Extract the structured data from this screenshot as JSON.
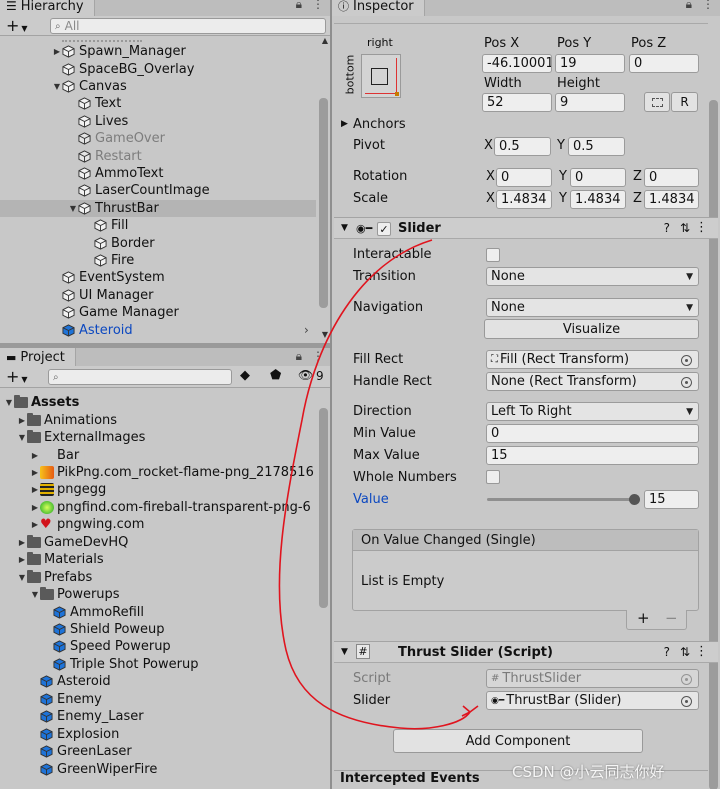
{
  "hierarchy": {
    "tab": "Hierarchy",
    "search_placeholder": "All",
    "items": [
      {
        "label": "Spawn_Manager",
        "depth": 1,
        "arrow": "▶",
        "style": ""
      },
      {
        "label": "SpaceBG_Overlay",
        "depth": 1,
        "arrow": "",
        "style": ""
      },
      {
        "label": "Canvas",
        "depth": 1,
        "arrow": "▼",
        "style": ""
      },
      {
        "label": "Text",
        "depth": 2,
        "arrow": "",
        "style": ""
      },
      {
        "label": "Lives",
        "depth": 2,
        "arrow": "",
        "style": ""
      },
      {
        "label": "GameOver",
        "depth": 2,
        "arrow": "",
        "style": "dim"
      },
      {
        "label": "Restart",
        "depth": 2,
        "arrow": "",
        "style": "dim"
      },
      {
        "label": "AmmoText",
        "depth": 2,
        "arrow": "",
        "style": ""
      },
      {
        "label": "LaserCountImage",
        "depth": 2,
        "arrow": "",
        "style": ""
      },
      {
        "label": "ThrustBar",
        "depth": 2,
        "arrow": "▼",
        "style": "selected"
      },
      {
        "label": "Fill",
        "depth": 3,
        "arrow": "",
        "style": ""
      },
      {
        "label": "Border",
        "depth": 3,
        "arrow": "",
        "style": ""
      },
      {
        "label": "Fire",
        "depth": 3,
        "arrow": "",
        "style": ""
      },
      {
        "label": "EventSystem",
        "depth": 1,
        "arrow": "",
        "style": ""
      },
      {
        "label": "UI Manager",
        "depth": 1,
        "arrow": "",
        "style": ""
      },
      {
        "label": "Game Manager",
        "depth": 1,
        "arrow": "",
        "style": ""
      },
      {
        "label": "Asteroid",
        "depth": 1,
        "arrow": "",
        "style": "blue"
      }
    ]
  },
  "project": {
    "tab": "Project",
    "badge_count": "9",
    "items": [
      {
        "label": "Assets",
        "depth": 0,
        "arrow": "▼",
        "icon": "folder",
        "bold": true
      },
      {
        "label": "Animations",
        "depth": 1,
        "arrow": "▶",
        "icon": "folder"
      },
      {
        "label": "ExternalImages",
        "depth": 1,
        "arrow": "▼",
        "icon": "folder"
      },
      {
        "label": "Bar",
        "depth": 2,
        "arrow": "▶",
        "icon": "none"
      },
      {
        "label": "PikPng.com_rocket-flame-png_2178516",
        "depth": 2,
        "arrow": "▶",
        "icon": "flame"
      },
      {
        "label": "pngegg",
        "depth": 2,
        "arrow": "▶",
        "icon": "pngegg"
      },
      {
        "label": "pngfind.com-fireball-transparent-png-6",
        "depth": 2,
        "arrow": "▶",
        "icon": "fireball"
      },
      {
        "label": "pngwing.com",
        "depth": 2,
        "arrow": "▶",
        "icon": "heart"
      },
      {
        "label": "GameDevHQ",
        "depth": 1,
        "arrow": "▶",
        "icon": "folder"
      },
      {
        "label": "Materials",
        "depth": 1,
        "arrow": "▶",
        "icon": "folder"
      },
      {
        "label": "Prefabs",
        "depth": 1,
        "arrow": "▼",
        "icon": "folder"
      },
      {
        "label": "Powerups",
        "depth": 2,
        "arrow": "▼",
        "icon": "folder"
      },
      {
        "label": "AmmoRefill",
        "depth": 3,
        "arrow": "",
        "icon": "prefab"
      },
      {
        "label": "Shield Poweup",
        "depth": 3,
        "arrow": "",
        "icon": "prefab"
      },
      {
        "label": "Speed Powerup",
        "depth": 3,
        "arrow": "",
        "icon": "prefab"
      },
      {
        "label": "Triple Shot Powerup",
        "depth": 3,
        "arrow": "",
        "icon": "prefab"
      },
      {
        "label": "Asteroid",
        "depth": 2,
        "arrow": "",
        "icon": "prefab"
      },
      {
        "label": "Enemy",
        "depth": 2,
        "arrow": "",
        "icon": "prefab"
      },
      {
        "label": "Enemy_Laser",
        "depth": 2,
        "arrow": "",
        "icon": "prefab"
      },
      {
        "label": "Explosion",
        "depth": 2,
        "arrow": "",
        "icon": "prefab"
      },
      {
        "label": "GreenLaser",
        "depth": 2,
        "arrow": "",
        "icon": "prefab"
      },
      {
        "label": "GreenWiperFire",
        "depth": 2,
        "arrow": "",
        "icon": "prefab"
      }
    ]
  },
  "inspector": {
    "tab": "Inspector",
    "rect": {
      "anchor_label_top": "right",
      "anchor_label_side": "bottom",
      "posx_label": "Pos X",
      "posy_label": "Pos Y",
      "posz_label": "Pos Z",
      "posx": "-46.10001",
      "posy": "19",
      "posz": "0",
      "width_label": "Width",
      "height_label": "Height",
      "width": "52",
      "height": "9",
      "r_button": "R",
      "anchors_label": "Anchors",
      "pivot_label": "Pivot",
      "pivot_x_label": "X",
      "pivot_y_label": "Y",
      "pivot_x": "0.5",
      "pivot_y": "0.5",
      "rotation_label": "Rotation",
      "rot_x": "0",
      "rot_y": "0",
      "rot_z": "0",
      "scale_label": "Scale",
      "scale_x": "1.4834",
      "scale_y": "1.4834",
      "scale_z": "1.4834",
      "x_label": "X",
      "y_label": "Y",
      "z_label": "Z"
    },
    "slider": {
      "title": "Slider",
      "interactable_label": "Interactable",
      "transition_label": "Transition",
      "transition": "None",
      "navigation_label": "Navigation",
      "navigation": "None",
      "visualize_button": "Visualize",
      "fill_rect_label": "Fill Rect",
      "fill_rect": "Fill (Rect Transform)",
      "handle_rect_label": "Handle Rect",
      "handle_rect": "None (Rect Transform)",
      "direction_label": "Direction",
      "direction": "Left To Right",
      "min_label": "Min Value",
      "min": "0",
      "max_label": "Max Value",
      "max": "15",
      "whole_label": "Whole Numbers",
      "value_label": "Value",
      "value": "15",
      "value_fraction": 1.0,
      "event_title": "On Value Changed (Single)",
      "event_empty": "List is Empty"
    },
    "script": {
      "title": "Thrust Slider (Script)",
      "script_label": "Script",
      "script_value": "ThrustSlider",
      "slider_label": "Slider",
      "slider_value": "ThrustBar (Slider)"
    },
    "add_component": "Add Component",
    "intercepted_events": "Intercepted Events"
  },
  "watermark": "CSDN @小云同志你好",
  "colors": {
    "annotation": "#e0141e",
    "link_blue": "#0c48c0",
    "prefab_blue": "#1e73d8"
  }
}
